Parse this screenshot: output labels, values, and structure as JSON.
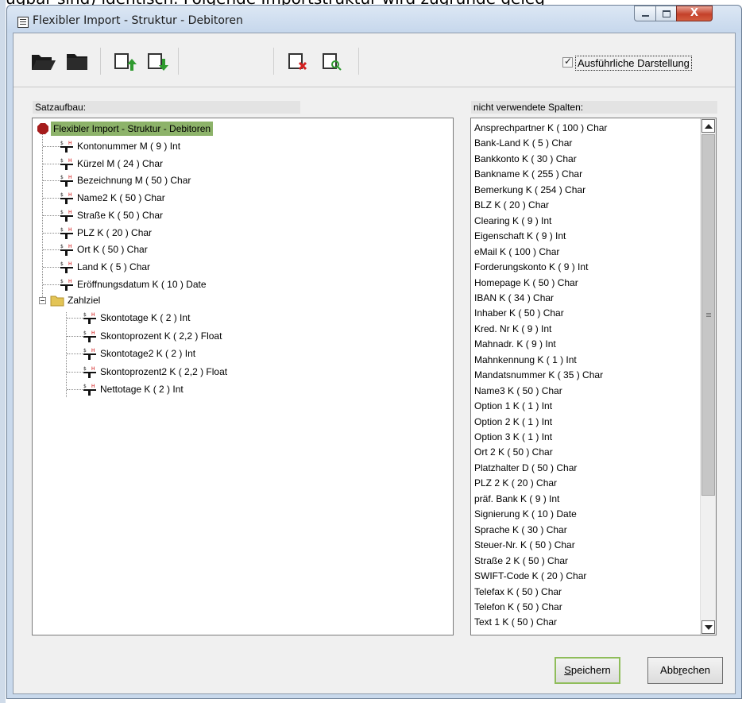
{
  "background_text": "fügbar sind) identisch. Folgende Importstruktur wird zugrunde geleg",
  "window": {
    "title": "Flexibler Import - Struktur - Debitoren",
    "close_glyph": "X"
  },
  "toolbar": {
    "icons": [
      "folder-open-icon",
      "folder-icon",
      "export-icon",
      "import-icon",
      "delete-icon",
      "preview-icon"
    ],
    "verbose_checkbox": {
      "label": "Ausführliche Darstellung",
      "checked": true
    }
  },
  "left_panel": {
    "label": "Satzaufbau:",
    "root": "Flexibler Import - Struktur - Debitoren",
    "fields": [
      "Kontonummer  M  ( 9 ) Int",
      "Kürzel  M  ( 24 ) Char",
      "Bezeichnung  M  ( 50 ) Char",
      "Name2  K  ( 50 ) Char",
      "Straße  K  ( 50 ) Char",
      "PLZ  K  ( 20 ) Char",
      "Ort  K  ( 50 ) Char",
      "Land  K  ( 5 ) Char",
      "Eröffnungsdatum  K  ( 10 ) Date"
    ],
    "folder": {
      "label": "Zahlziel",
      "children": [
        "Skontotage  K  ( 2 ) Int",
        "Skontoprozent  K  ( 2,2 ) Float",
        "Skontotage2  K  ( 2 ) Int",
        "Skontoprozent2  K  ( 2,2 ) Float",
        "Nettotage  K  ( 2 ) Int"
      ]
    }
  },
  "right_panel": {
    "label": "nicht verwendete Spalten:",
    "items": [
      "Ansprechpartner  K  ( 100 ) Char",
      "Bank-Land  K  ( 5 ) Char",
      "Bankkonto  K  ( 30 ) Char",
      "Bankname  K  ( 255 ) Char",
      "Bemerkung  K  ( 254 ) Char",
      "BLZ  K  ( 20 ) Char",
      "Clearing  K  ( 9 ) Int",
      "Eigenschaft  K  ( 9 ) Int",
      "eMail  K  ( 100 ) Char",
      "Forderungskonto  K  ( 9 ) Int",
      "Homepage  K  ( 50 ) Char",
      "IBAN  K  ( 34 ) Char",
      "Inhaber  K  ( 50 ) Char",
      "Kred. Nr  K  ( 9 ) Int",
      "Mahnadr.  K  ( 9 ) Int",
      "Mahnkennung  K  ( 1 ) Int",
      "Mandatsnummer  K  ( 35 ) Char",
      "Name3  K  ( 50 ) Char",
      "Option 1  K  ( 1 ) Int",
      "Option 2  K  ( 1 ) Int",
      "Option 3  K  ( 1 ) Int",
      "Ort 2  K  ( 50 ) Char",
      "Platzhalter  D  ( 50 ) Char",
      "PLZ 2  K  ( 20 ) Char",
      "präf. Bank  K  ( 9 ) Int",
      "Signierung  K  ( 10 ) Date",
      "Sprache  K  ( 30 ) Char",
      "Steuer-Nr.  K  ( 50 ) Char",
      "Straße 2  K  ( 50 ) Char",
      "SWIFT-Code  K  ( 20 ) Char",
      "Telefax  K  ( 50 ) Char",
      "Telefon  K  ( 50 ) Char",
      "Text 1  K  ( 50 ) Char"
    ]
  },
  "buttons": {
    "save": {
      "accel": "S",
      "rest": "peichern"
    },
    "cancel": {
      "pre": "Abb",
      "accel": "r",
      "post": "echen"
    }
  },
  "colors": {
    "root_highlight": "#8db36a",
    "primary_border": "#8fbd5a",
    "close_button": "#c4412a"
  }
}
